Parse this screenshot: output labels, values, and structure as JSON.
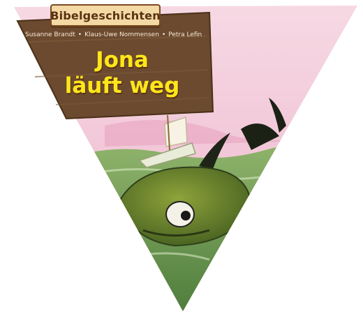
{
  "book": {
    "series": "Bibelgeschichten",
    "authors": [
      "Susanne Brandt",
      "Klaus-Uwe Nommensen",
      "Petra Lefin"
    ],
    "title_lines": [
      "Jona",
      "läuft weg"
    ]
  },
  "colors": {
    "sky": "#f2c7d8",
    "wood": "#6b4a2f",
    "title": "#ffe61a",
    "sea": "#6c9b52",
    "fish": "#5f7d2c"
  }
}
